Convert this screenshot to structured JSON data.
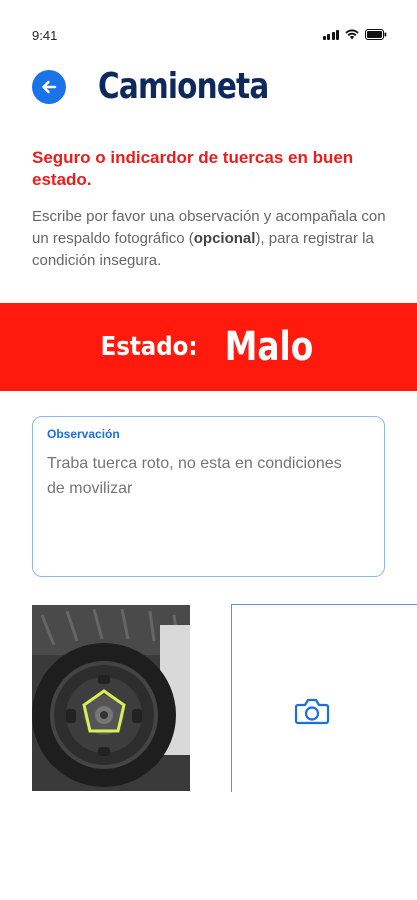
{
  "status_bar": {
    "time": "9:41"
  },
  "header": {
    "title": "Camioneta"
  },
  "item": {
    "title": "Seguro o indicardor de tuercas en buen estado."
  },
  "instructions": {
    "before": "Escribe por favor una observación y acompañala con un respaldo fotográfico (",
    "emphasis": "opcional",
    "after": "), para registrar la condición insegura."
  },
  "state": {
    "label": "Estado:",
    "value": "Malo"
  },
  "observation": {
    "label": "Observación",
    "placeholder": "Traba tuerca roto, no esta en condiciones de movilizar"
  },
  "colors": {
    "accent": "#1a74e8",
    "alert": "#ff1a0d",
    "title": "#0e2a5c"
  },
  "icons": [
    "back-arrow-icon",
    "camera-icon",
    "signal-icon",
    "wifi-icon",
    "battery-icon"
  ]
}
